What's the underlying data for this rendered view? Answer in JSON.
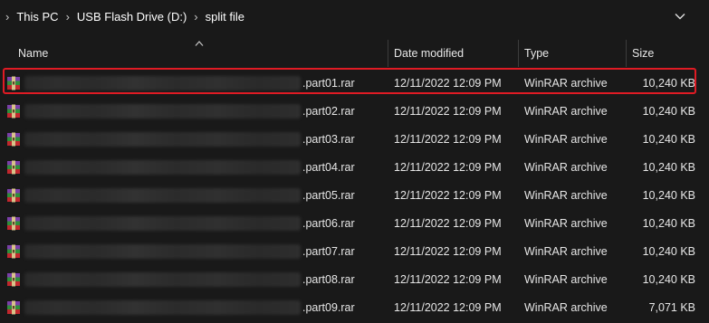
{
  "breadcrumb": {
    "items": [
      "This PC",
      "USB Flash Drive (D:)",
      "split file"
    ]
  },
  "columns": {
    "name": "Name",
    "date_modified": "Date modified",
    "type": "Type",
    "size": "Size"
  },
  "files": [
    {
      "name": ".part01.rar",
      "date": "12/11/2022 12:09 PM",
      "type": "WinRAR archive",
      "size": "10,240 KB",
      "selected": true
    },
    {
      "name": ".part02.rar",
      "date": "12/11/2022 12:09 PM",
      "type": "WinRAR archive",
      "size": "10,240 KB"
    },
    {
      "name": ".part03.rar",
      "date": "12/11/2022 12:09 PM",
      "type": "WinRAR archive",
      "size": "10,240 KB"
    },
    {
      "name": ".part04.rar",
      "date": "12/11/2022 12:09 PM",
      "type": "WinRAR archive",
      "size": "10,240 KB"
    },
    {
      "name": ".part05.rar",
      "date": "12/11/2022 12:09 PM",
      "type": "WinRAR archive",
      "size": "10,240 KB"
    },
    {
      "name": ".part06.rar",
      "date": "12/11/2022 12:09 PM",
      "type": "WinRAR archive",
      "size": "10,240 KB"
    },
    {
      "name": ".part07.rar",
      "date": "12/11/2022 12:09 PM",
      "type": "WinRAR archive",
      "size": "10,240 KB"
    },
    {
      "name": ".part08.rar",
      "date": "12/11/2022 12:09 PM",
      "type": "WinRAR archive",
      "size": "10,240 KB"
    },
    {
      "name": ".part09.rar",
      "date": "12/11/2022 12:09 PM",
      "type": "WinRAR archive",
      "size": "7,071 KB"
    }
  ],
  "colors": {
    "background": "#191919",
    "highlight_border": "#e01b24",
    "text": "#e6e6e6"
  },
  "icons": {
    "file": "winrar-archive-icon",
    "sort": "sort-ascending-icon",
    "dropdown": "chevron-down-icon",
    "separator": "chevron-right-icon"
  }
}
